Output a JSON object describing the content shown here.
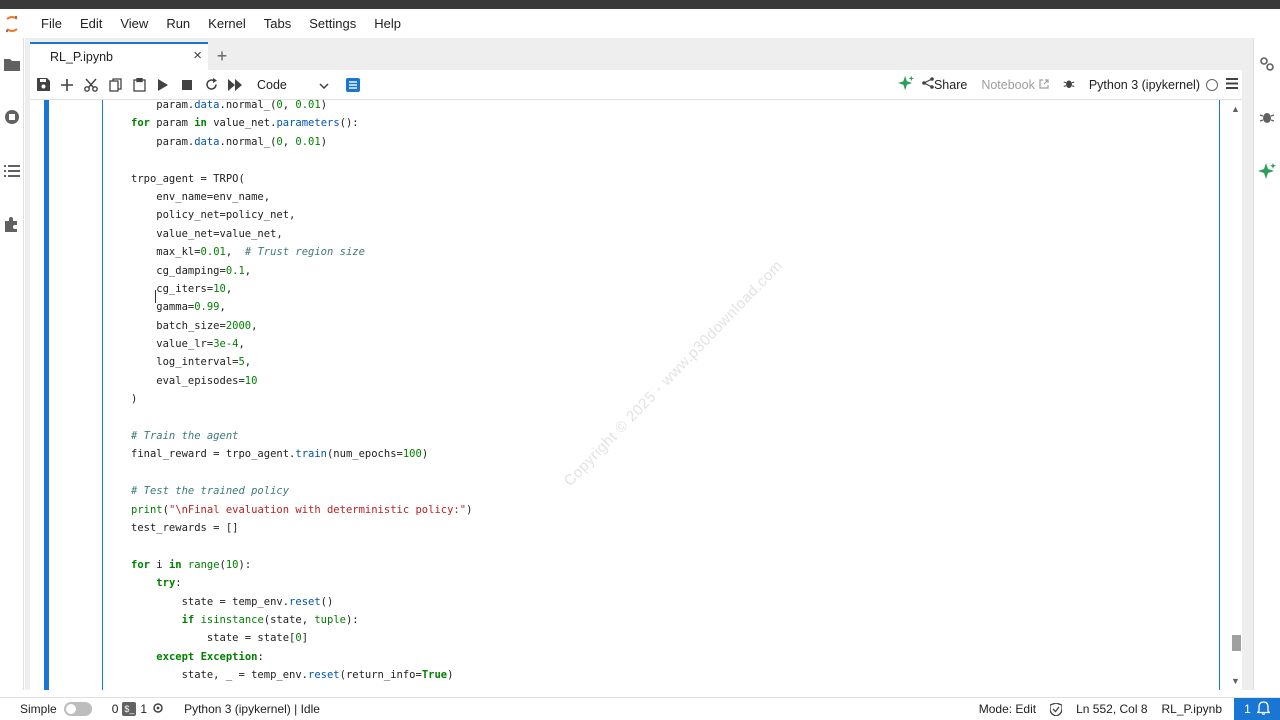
{
  "menu": {
    "items": [
      "File",
      "Edit",
      "View",
      "Run",
      "Kernel",
      "Tabs",
      "Settings",
      "Help"
    ]
  },
  "tab": {
    "title": "RL_P.ipynb",
    "close": "×",
    "add": "+"
  },
  "toolbar": {
    "cell_type": "Code",
    "share_label": "Share",
    "notebook_label": "Notebook",
    "kernel_label": "Python 3 (ipykernel)"
  },
  "code_lines": [
    [
      {
        "t": "    param.",
        "c": ""
      },
      {
        "t": "data",
        "c": "attr"
      },
      {
        "t": ".normal_(",
        "c": ""
      },
      {
        "t": "0",
        "c": "num"
      },
      {
        "t": ", ",
        "c": ""
      },
      {
        "t": "0.01",
        "c": "num"
      },
      {
        "t": ")",
        "c": ""
      }
    ],
    [
      {
        "t": "for",
        "c": "kw"
      },
      {
        "t": " param ",
        "c": ""
      },
      {
        "t": "in",
        "c": "kw"
      },
      {
        "t": " value_net.",
        "c": ""
      },
      {
        "t": "parameters",
        "c": "attr"
      },
      {
        "t": "():",
        "c": ""
      }
    ],
    [
      {
        "t": "    param.",
        "c": ""
      },
      {
        "t": "data",
        "c": "attr"
      },
      {
        "t": ".normal_(",
        "c": ""
      },
      {
        "t": "0",
        "c": "num"
      },
      {
        "t": ", ",
        "c": ""
      },
      {
        "t": "0.01",
        "c": "num"
      },
      {
        "t": ")",
        "c": ""
      }
    ],
    [
      {
        "t": "",
        "c": ""
      }
    ],
    [
      {
        "t": "trpo_agent = TRPO(",
        "c": ""
      }
    ],
    [
      {
        "t": "    env_name=env_name,",
        "c": ""
      }
    ],
    [
      {
        "t": "    policy_net=policy_net,",
        "c": ""
      }
    ],
    [
      {
        "t": "    value_net=value_net,",
        "c": ""
      }
    ],
    [
      {
        "t": "    max_kl=",
        "c": ""
      },
      {
        "t": "0.01",
        "c": "num"
      },
      {
        "t": ",  ",
        "c": ""
      },
      {
        "t": "# Trust region size",
        "c": "com"
      }
    ],
    [
      {
        "t": "    cg_damping=",
        "c": ""
      },
      {
        "t": "0.1",
        "c": "num"
      },
      {
        "t": ",",
        "c": ""
      }
    ],
    [
      {
        "t": "    cg_iters=",
        "c": ""
      },
      {
        "t": "10",
        "c": "num"
      },
      {
        "t": ",",
        "c": ""
      }
    ],
    [
      {
        "t": "    gamma=",
        "c": ""
      },
      {
        "t": "0.99",
        "c": "num"
      },
      {
        "t": ",",
        "c": ""
      }
    ],
    [
      {
        "t": "    batch_size=",
        "c": ""
      },
      {
        "t": "2000",
        "c": "num"
      },
      {
        "t": ",",
        "c": ""
      }
    ],
    [
      {
        "t": "    value_lr=",
        "c": ""
      },
      {
        "t": "3e-4",
        "c": "num"
      },
      {
        "t": ",",
        "c": ""
      }
    ],
    [
      {
        "t": "    log_interval=",
        "c": ""
      },
      {
        "t": "5",
        "c": "num"
      },
      {
        "t": ",",
        "c": ""
      }
    ],
    [
      {
        "t": "    eval_episodes=",
        "c": ""
      },
      {
        "t": "10",
        "c": "num"
      }
    ],
    [
      {
        "t": ")",
        "c": ""
      }
    ],
    [
      {
        "t": "",
        "c": ""
      }
    ],
    [
      {
        "t": "# Train the agent",
        "c": "com"
      }
    ],
    [
      {
        "t": "final_reward = trpo_agent.",
        "c": ""
      },
      {
        "t": "train",
        "c": "attr"
      },
      {
        "t": "(num_epochs=",
        "c": ""
      },
      {
        "t": "100",
        "c": "num"
      },
      {
        "t": ")",
        "c": ""
      }
    ],
    [
      {
        "t": "",
        "c": ""
      }
    ],
    [
      {
        "t": "# Test the trained policy",
        "c": "com"
      }
    ],
    [
      {
        "t": "print",
        "c": "bi"
      },
      {
        "t": "(",
        "c": ""
      },
      {
        "t": "\"\\nFinal evaluation with deterministic policy:\"",
        "c": "str"
      },
      {
        "t": ")",
        "c": ""
      }
    ],
    [
      {
        "t": "test_rewards = []",
        "c": ""
      }
    ],
    [
      {
        "t": "",
        "c": ""
      }
    ],
    [
      {
        "t": "for",
        "c": "kw"
      },
      {
        "t": " i ",
        "c": ""
      },
      {
        "t": "in",
        "c": "kw"
      },
      {
        "t": " ",
        "c": ""
      },
      {
        "t": "range",
        "c": "bi"
      },
      {
        "t": "(",
        "c": ""
      },
      {
        "t": "10",
        "c": "num"
      },
      {
        "t": "):",
        "c": ""
      }
    ],
    [
      {
        "t": "    ",
        "c": ""
      },
      {
        "t": "try",
        "c": "kw"
      },
      {
        "t": ":",
        "c": ""
      }
    ],
    [
      {
        "t": "        state = temp_env.",
        "c": ""
      },
      {
        "t": "reset",
        "c": "attr"
      },
      {
        "t": "()",
        "c": ""
      }
    ],
    [
      {
        "t": "        ",
        "c": ""
      },
      {
        "t": "if",
        "c": "kw"
      },
      {
        "t": " ",
        "c": ""
      },
      {
        "t": "isinstance",
        "c": "bi"
      },
      {
        "t": "(state, ",
        "c": ""
      },
      {
        "t": "tuple",
        "c": "bi"
      },
      {
        "t": "):",
        "c": ""
      }
    ],
    [
      {
        "t": "            state = state[",
        "c": ""
      },
      {
        "t": "0",
        "c": "num"
      },
      {
        "t": "]",
        "c": ""
      }
    ],
    [
      {
        "t": "    ",
        "c": ""
      },
      {
        "t": "except",
        "c": "kw"
      },
      {
        "t": " ",
        "c": ""
      },
      {
        "t": "Exception",
        "c": "kw"
      },
      {
        "t": ":",
        "c": ""
      }
    ],
    [
      {
        "t": "        state, _ = temp_env.",
        "c": ""
      },
      {
        "t": "reset",
        "c": "attr"
      },
      {
        "t": "(return_info=",
        "c": ""
      },
      {
        "t": "True",
        "c": "kw"
      },
      {
        "t": ")",
        "c": ""
      }
    ]
  ],
  "watermark": "Copyright © 2025 - www.p30download.com",
  "status": {
    "mode_label": "Simple",
    "terminals": "0",
    "kernels": "1",
    "kernel_status": "Python 3 (ipykernel) | Idle",
    "edit_mode": "Mode: Edit",
    "position": "Ln 552, Col 8",
    "file": "RL_P.ipynb",
    "notifications": "1"
  },
  "colors": {
    "accent": "#1976d2",
    "keyword": "#008000",
    "comment": "#3d7a7a",
    "string": "#ba2121"
  }
}
